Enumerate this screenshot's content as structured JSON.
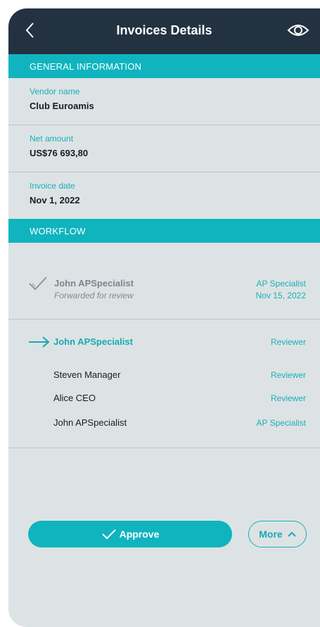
{
  "header": {
    "title": "Invoices Details",
    "back_icon": "chevron-left-icon",
    "view_icon": "eye-icon"
  },
  "general": {
    "section_label": "GENERAL INFORMATION",
    "fields": [
      {
        "label": "Vendor name",
        "value": "Club Euroamis"
      },
      {
        "label": "Net amount",
        "value": "US$76 693,80"
      },
      {
        "label": "Invoice date",
        "value": "Nov 1, 2022"
      }
    ]
  },
  "workflow": {
    "section_label": "WORKFLOW",
    "completed": {
      "icon": "check-icon",
      "name": "John APSpecialist",
      "status": "Forwarded for review",
      "role": "AP Specialist",
      "date": "Nov 15, 2022"
    },
    "steps": [
      {
        "name": "John APSpecialist",
        "role": "Reviewer",
        "current": true,
        "icon": "arrow-right-icon"
      },
      {
        "name": "Steven Manager",
        "role": "Reviewer"
      },
      {
        "name": "Alice CEO",
        "role": "Reviewer"
      },
      {
        "name": "John APSpecialist",
        "role": "AP Specialist"
      }
    ]
  },
  "actions": {
    "approve_label": "Approve",
    "more_label": "More"
  },
  "colors": {
    "header_bg": "#233240",
    "accent": "#0fb4bf",
    "background": "#dde3e4"
  }
}
